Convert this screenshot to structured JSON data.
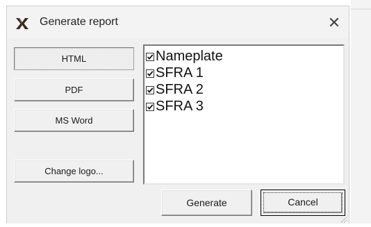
{
  "window": {
    "title": "Generate report",
    "close_glyph": "✕",
    "icon": "x-logo-icon"
  },
  "left_panel": {
    "buttons": [
      {
        "label": "HTML",
        "pressed": true
      },
      {
        "label": "PDF",
        "pressed": false
      },
      {
        "label": "MS Word",
        "pressed": false
      }
    ],
    "logo_button": "Change logo..."
  },
  "report_items": [
    {
      "label": "Nameplate",
      "checked": true
    },
    {
      "label": "SFRA 1",
      "checked": true
    },
    {
      "label": "SFRA 2",
      "checked": true
    },
    {
      "label": "SFRA 3",
      "checked": true
    }
  ],
  "footer": {
    "generate_label": "Generate",
    "cancel_label": "Cancel"
  }
}
